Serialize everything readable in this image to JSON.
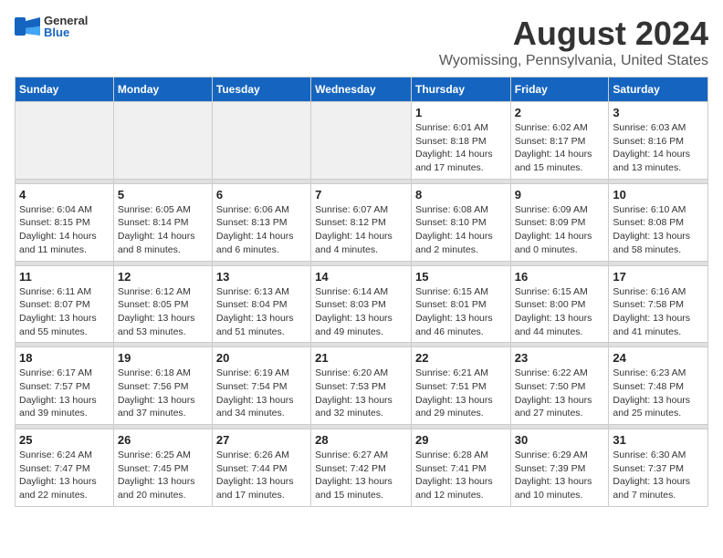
{
  "header": {
    "logo_general": "General",
    "logo_blue": "Blue",
    "month_title": "August 2024",
    "location": "Wyomissing, Pennsylvania, United States"
  },
  "days_of_week": [
    "Sunday",
    "Monday",
    "Tuesday",
    "Wednesday",
    "Thursday",
    "Friday",
    "Saturday"
  ],
  "weeks": [
    [
      {
        "day": "",
        "info": ""
      },
      {
        "day": "",
        "info": ""
      },
      {
        "day": "",
        "info": ""
      },
      {
        "day": "",
        "info": ""
      },
      {
        "day": "1",
        "info": "Sunrise: 6:01 AM\nSunset: 8:18 PM\nDaylight: 14 hours\nand 17 minutes."
      },
      {
        "day": "2",
        "info": "Sunrise: 6:02 AM\nSunset: 8:17 PM\nDaylight: 14 hours\nand 15 minutes."
      },
      {
        "day": "3",
        "info": "Sunrise: 6:03 AM\nSunset: 8:16 PM\nDaylight: 14 hours\nand 13 minutes."
      }
    ],
    [
      {
        "day": "4",
        "info": "Sunrise: 6:04 AM\nSunset: 8:15 PM\nDaylight: 14 hours\nand 11 minutes."
      },
      {
        "day": "5",
        "info": "Sunrise: 6:05 AM\nSunset: 8:14 PM\nDaylight: 14 hours\nand 8 minutes."
      },
      {
        "day": "6",
        "info": "Sunrise: 6:06 AM\nSunset: 8:13 PM\nDaylight: 14 hours\nand 6 minutes."
      },
      {
        "day": "7",
        "info": "Sunrise: 6:07 AM\nSunset: 8:12 PM\nDaylight: 14 hours\nand 4 minutes."
      },
      {
        "day": "8",
        "info": "Sunrise: 6:08 AM\nSunset: 8:10 PM\nDaylight: 14 hours\nand 2 minutes."
      },
      {
        "day": "9",
        "info": "Sunrise: 6:09 AM\nSunset: 8:09 PM\nDaylight: 14 hours\nand 0 minutes."
      },
      {
        "day": "10",
        "info": "Sunrise: 6:10 AM\nSunset: 8:08 PM\nDaylight: 13 hours\nand 58 minutes."
      }
    ],
    [
      {
        "day": "11",
        "info": "Sunrise: 6:11 AM\nSunset: 8:07 PM\nDaylight: 13 hours\nand 55 minutes."
      },
      {
        "day": "12",
        "info": "Sunrise: 6:12 AM\nSunset: 8:05 PM\nDaylight: 13 hours\nand 53 minutes."
      },
      {
        "day": "13",
        "info": "Sunrise: 6:13 AM\nSunset: 8:04 PM\nDaylight: 13 hours\nand 51 minutes."
      },
      {
        "day": "14",
        "info": "Sunrise: 6:14 AM\nSunset: 8:03 PM\nDaylight: 13 hours\nand 49 minutes."
      },
      {
        "day": "15",
        "info": "Sunrise: 6:15 AM\nSunset: 8:01 PM\nDaylight: 13 hours\nand 46 minutes."
      },
      {
        "day": "16",
        "info": "Sunrise: 6:15 AM\nSunset: 8:00 PM\nDaylight: 13 hours\nand 44 minutes."
      },
      {
        "day": "17",
        "info": "Sunrise: 6:16 AM\nSunset: 7:58 PM\nDaylight: 13 hours\nand 41 minutes."
      }
    ],
    [
      {
        "day": "18",
        "info": "Sunrise: 6:17 AM\nSunset: 7:57 PM\nDaylight: 13 hours\nand 39 minutes."
      },
      {
        "day": "19",
        "info": "Sunrise: 6:18 AM\nSunset: 7:56 PM\nDaylight: 13 hours\nand 37 minutes."
      },
      {
        "day": "20",
        "info": "Sunrise: 6:19 AM\nSunset: 7:54 PM\nDaylight: 13 hours\nand 34 minutes."
      },
      {
        "day": "21",
        "info": "Sunrise: 6:20 AM\nSunset: 7:53 PM\nDaylight: 13 hours\nand 32 minutes."
      },
      {
        "day": "22",
        "info": "Sunrise: 6:21 AM\nSunset: 7:51 PM\nDaylight: 13 hours\nand 29 minutes."
      },
      {
        "day": "23",
        "info": "Sunrise: 6:22 AM\nSunset: 7:50 PM\nDaylight: 13 hours\nand 27 minutes."
      },
      {
        "day": "24",
        "info": "Sunrise: 6:23 AM\nSunset: 7:48 PM\nDaylight: 13 hours\nand 25 minutes."
      }
    ],
    [
      {
        "day": "25",
        "info": "Sunrise: 6:24 AM\nSunset: 7:47 PM\nDaylight: 13 hours\nand 22 minutes."
      },
      {
        "day": "26",
        "info": "Sunrise: 6:25 AM\nSunset: 7:45 PM\nDaylight: 13 hours\nand 20 minutes."
      },
      {
        "day": "27",
        "info": "Sunrise: 6:26 AM\nSunset: 7:44 PM\nDaylight: 13 hours\nand 17 minutes."
      },
      {
        "day": "28",
        "info": "Sunrise: 6:27 AM\nSunset: 7:42 PM\nDaylight: 13 hours\nand 15 minutes."
      },
      {
        "day": "29",
        "info": "Sunrise: 6:28 AM\nSunset: 7:41 PM\nDaylight: 13 hours\nand 12 minutes."
      },
      {
        "day": "30",
        "info": "Sunrise: 6:29 AM\nSunset: 7:39 PM\nDaylight: 13 hours\nand 10 minutes."
      },
      {
        "day": "31",
        "info": "Sunrise: 6:30 AM\nSunset: 7:37 PM\nDaylight: 13 hours\nand 7 minutes."
      }
    ]
  ]
}
